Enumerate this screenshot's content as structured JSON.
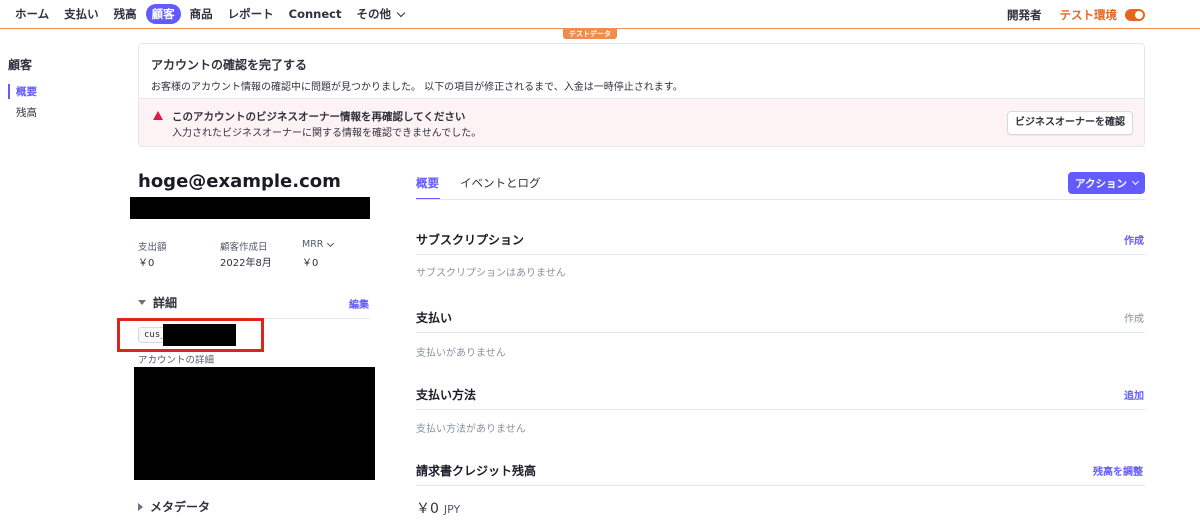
{
  "nav": {
    "items": [
      {
        "label": "ホーム",
        "active": false
      },
      {
        "label": "支払い",
        "active": false
      },
      {
        "label": "残高",
        "active": false
      },
      {
        "label": "顧客",
        "active": true
      },
      {
        "label": "商品",
        "active": false
      },
      {
        "label": "レポート",
        "active": false
      },
      {
        "label": "Connect",
        "active": false
      }
    ],
    "more_label": "その他",
    "developers": "開発者",
    "test_mode": "テスト環境",
    "test_badge": "テストデータ"
  },
  "sidebar": {
    "title": "顧客",
    "items": [
      {
        "label": "概要",
        "active": true
      },
      {
        "label": "残高",
        "active": false
      }
    ]
  },
  "banner": {
    "title": "アカウントの確認を完了する",
    "description": "お客様のアカウント情報の確認中に問題が見つかりました。 以下の項目が修正されるまで、入金は一時停止されます。",
    "alert_title": "このアカウントのビジネスオーナー情報を再確認してください",
    "alert_description": "入力されたビジネスオーナーに関する情報を確認できませんでした。",
    "alert_button": "ビジネスオーナーを確認"
  },
  "customer": {
    "email": "hoge@example.com",
    "stats": [
      {
        "label": "支出額",
        "value": "￥0"
      },
      {
        "label": "顧客作成日",
        "value": "2022年8月"
      },
      {
        "label": "MRR",
        "value": "￥0"
      }
    ],
    "details_title": "詳細",
    "edit_label": "編集",
    "customer_id_prefix": "cus_",
    "account_details_label": "アカウントの詳細",
    "metadata_title": "メタデータ"
  },
  "tabs": [
    {
      "label": "概要",
      "active": true
    },
    {
      "label": "イベントとログ",
      "active": false
    }
  ],
  "action_button": "アクション",
  "sections": {
    "subscriptions": {
      "title": "サブスクリプション",
      "action": "作成",
      "empty": "サブスクリプションはありません"
    },
    "payments": {
      "title": "支払い",
      "action": "作成",
      "empty": "支払いがありません"
    },
    "payment_methods": {
      "title": "支払い方法",
      "action": "追加",
      "empty": "支払い方法がありません"
    },
    "credit_balance": {
      "title": "請求書クレジット残高",
      "action": "残高を調整",
      "amount": "￥0",
      "currency": "JPY"
    }
  },
  "colors": {
    "accent": "#635bff",
    "test_mode": "#e5671f",
    "alert": "#df1b41",
    "annotation_box": "#e0241a"
  }
}
